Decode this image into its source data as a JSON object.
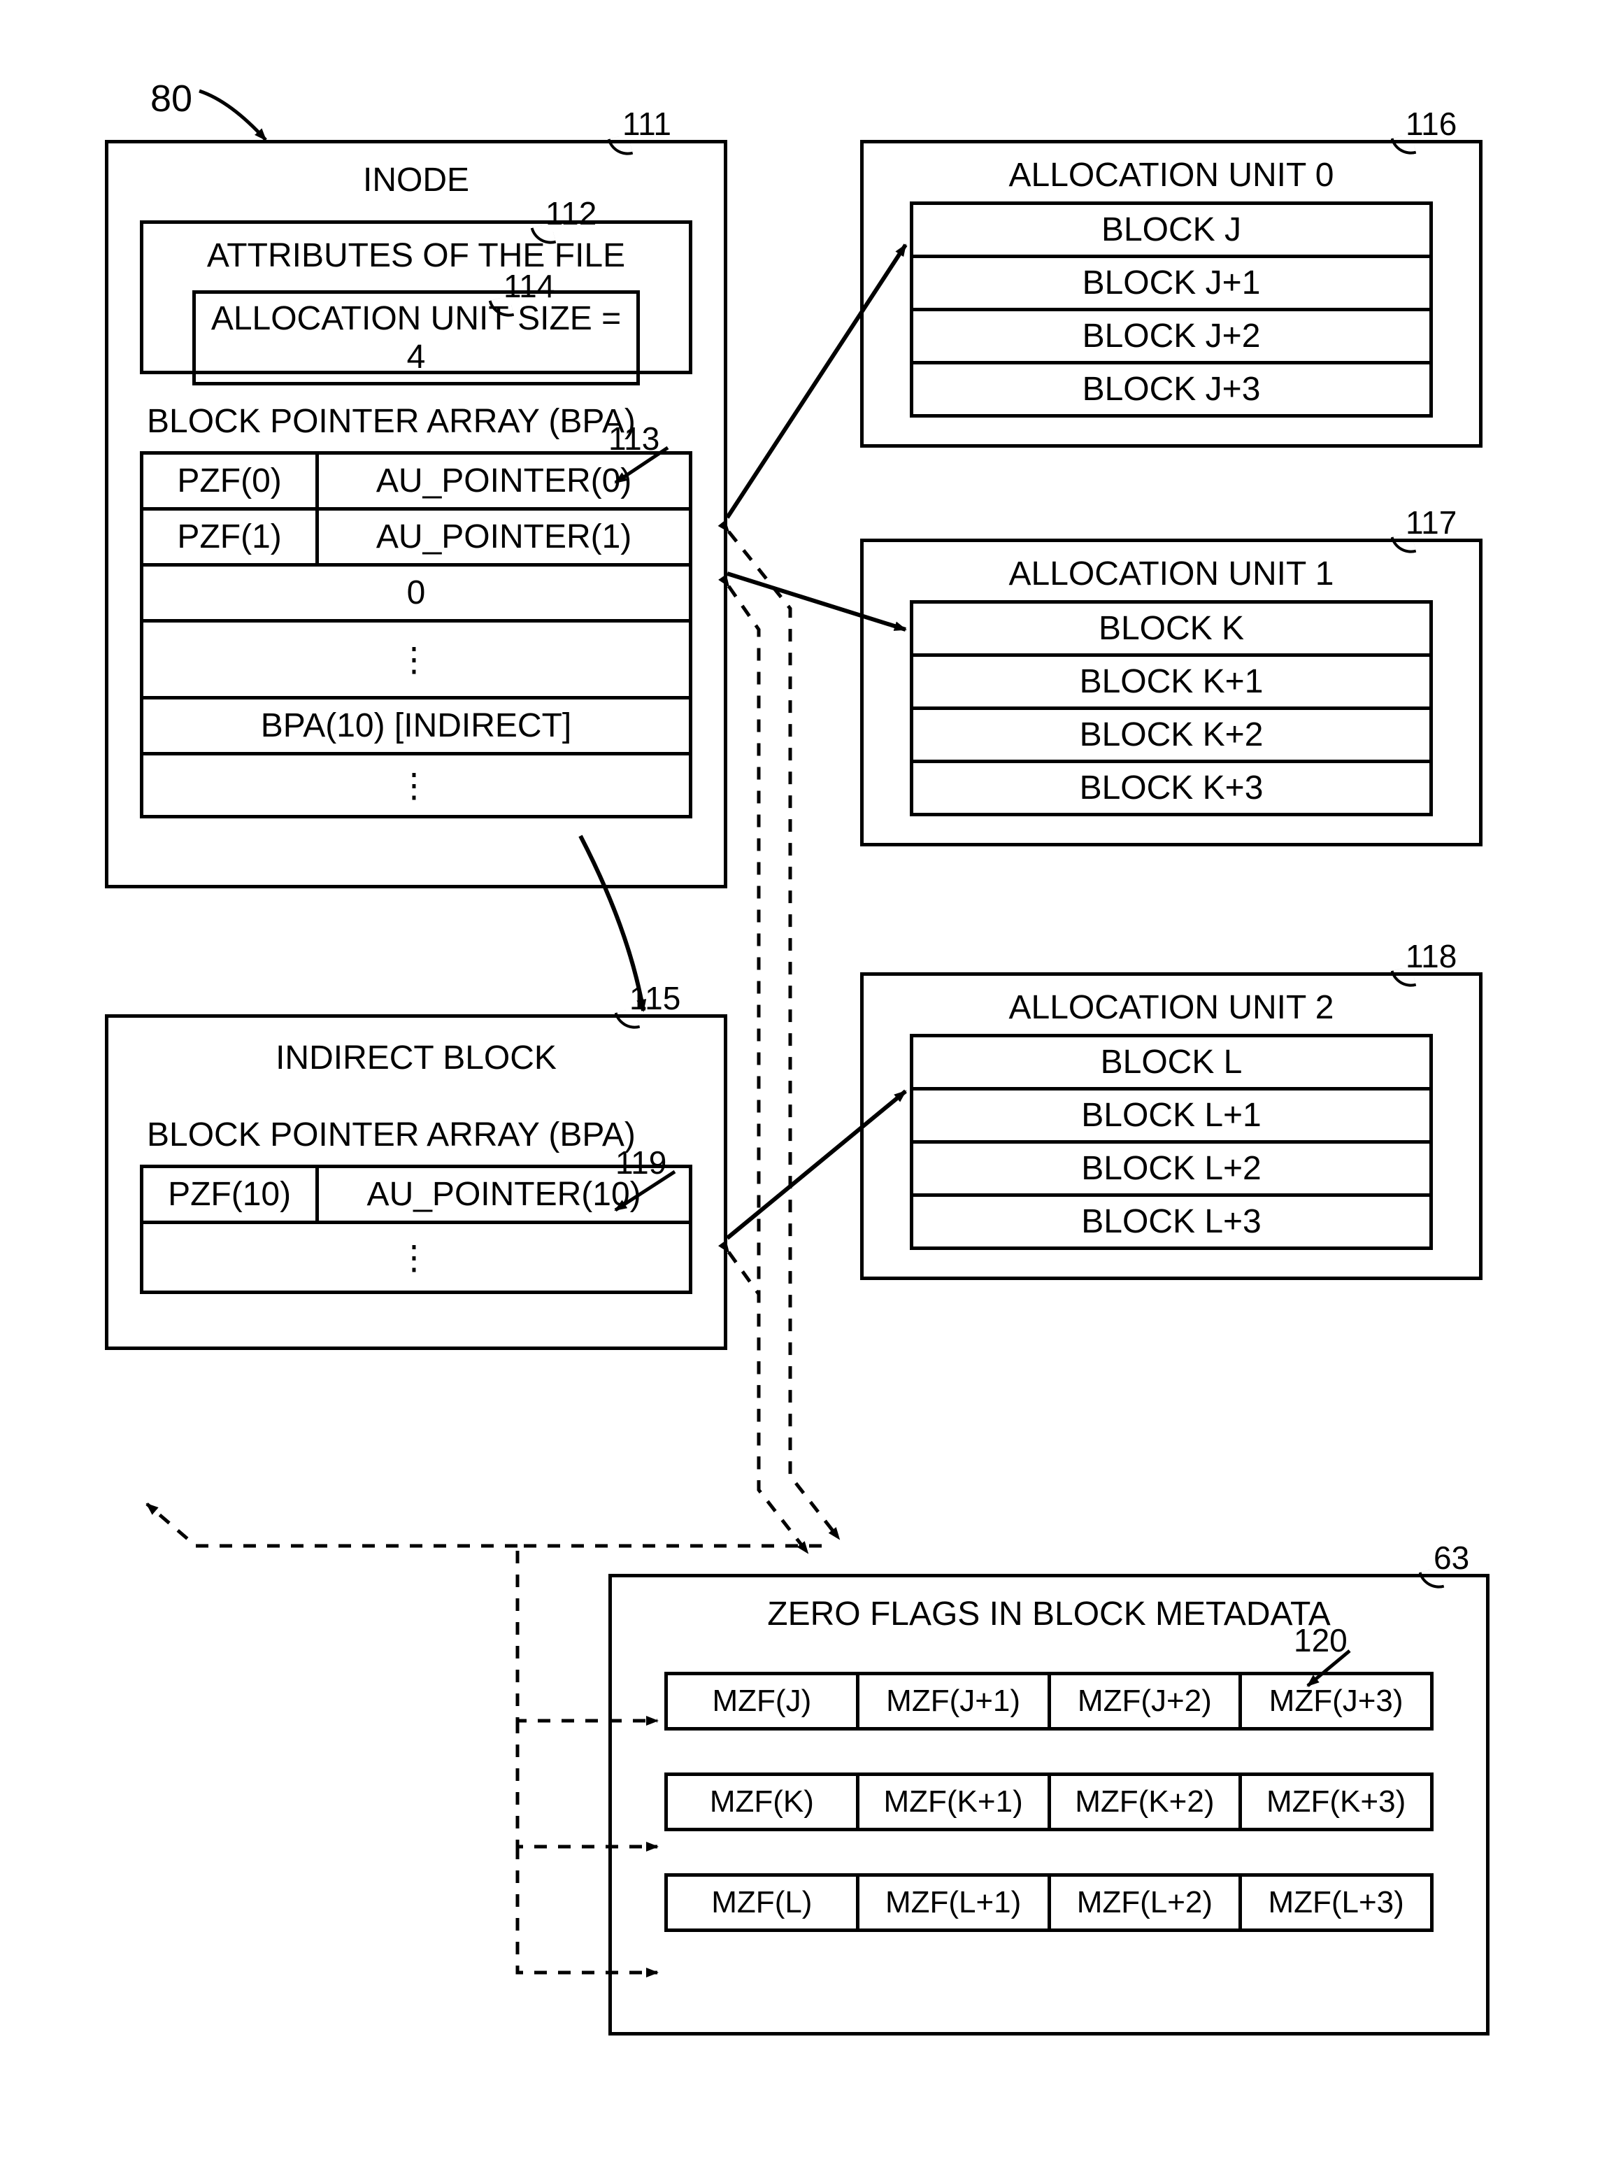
{
  "figNum": "80",
  "inode": {
    "ref": "111",
    "title": "INODE",
    "attrs": {
      "ref": "112",
      "title": "ATTRIBUTES OF THE FILE",
      "ausize": {
        "ref": "114",
        "text": "ALLOCATION UNIT SIZE = 4"
      }
    },
    "bpa": {
      "ref": "113",
      "title": "BLOCK POINTER ARRAY (BPA)",
      "rows": [
        {
          "pzf": "PZF(0)",
          "ptr": "AU_POINTER(0)"
        },
        {
          "pzf": "PZF(1)",
          "ptr": "AU_POINTER(1)"
        }
      ],
      "zero": "0",
      "indirect": "BPA(10)  [INDIRECT]"
    }
  },
  "indirect": {
    "ref": "115",
    "title": "INDIRECT BLOCK",
    "bpaTitle": "BLOCK POINTER ARRAY (BPA)",
    "bpaRef": "119",
    "row": {
      "pzf": "PZF(10)",
      "ptr": "AU_POINTER(10)"
    }
  },
  "au": [
    {
      "ref": "116",
      "title": "ALLOCATION UNIT 0",
      "blocks": [
        "BLOCK J",
        "BLOCK J+1",
        "BLOCK J+2",
        "BLOCK J+3"
      ]
    },
    {
      "ref": "117",
      "title": "ALLOCATION UNIT 1",
      "blocks": [
        "BLOCK K",
        "BLOCK K+1",
        "BLOCK K+2",
        "BLOCK K+3"
      ]
    },
    {
      "ref": "118",
      "title": "ALLOCATION UNIT 2",
      "blocks": [
        "BLOCK L",
        "BLOCK L+1",
        "BLOCK L+2",
        "BLOCK L+3"
      ]
    }
  ],
  "zeroflags": {
    "ref": "63",
    "title": "ZERO FLAGS IN BLOCK METADATA",
    "rowRef": "120",
    "rows": [
      [
        "MZF(J)",
        "MZF(J+1)",
        "MZF(J+2)",
        "MZF(J+3)"
      ],
      [
        "MZF(K)",
        "MZF(K+1)",
        "MZF(K+2)",
        "MZF(K+3)"
      ],
      [
        "MZF(L)",
        "MZF(L+1)",
        "MZF(L+2)",
        "MZF(L+3)"
      ]
    ]
  }
}
